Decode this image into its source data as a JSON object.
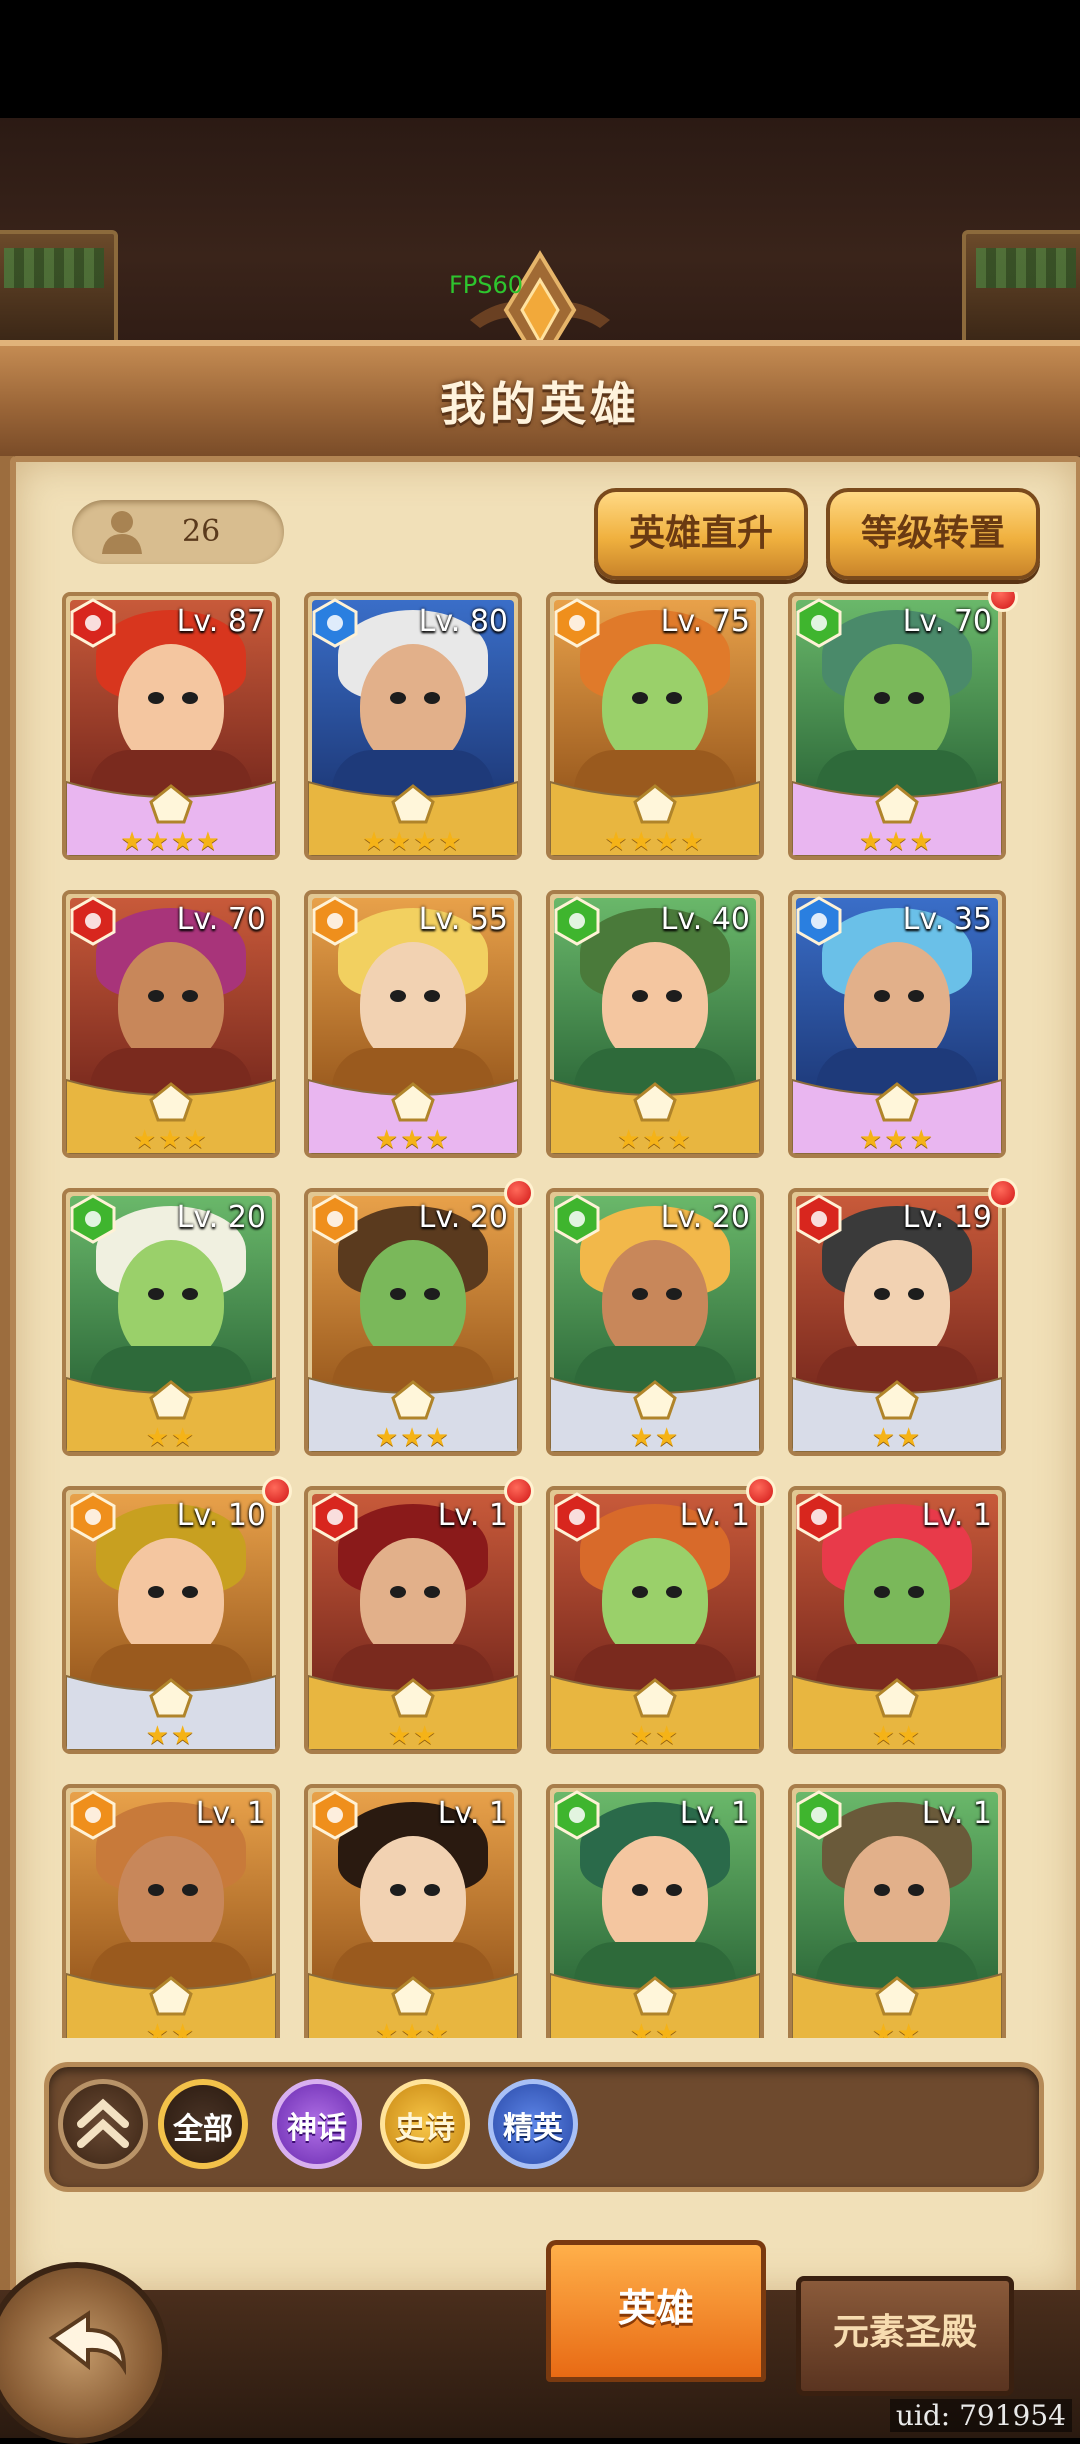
{
  "fps": "FPS60",
  "header": {
    "title": "我的英雄"
  },
  "hero_count": "26",
  "buttons": {
    "upgrade": "英雄直升",
    "transfer": "等级转置"
  },
  "colors": {
    "fire": "#d8261e",
    "water": "#2a7fe0",
    "earth": "#ef8f1c",
    "wind": "#3fb52e"
  },
  "heroes": [
    {
      "level": "Lv. 87",
      "element": "fire",
      "stars": "★★★★",
      "dot": false,
      "rarity": "mythic"
    },
    {
      "level": "Lv. 80",
      "element": "water",
      "stars": "★★★★",
      "dot": false,
      "rarity": "epic"
    },
    {
      "level": "Lv. 75",
      "element": "earth",
      "stars": "★★★★",
      "dot": false,
      "rarity": "epic"
    },
    {
      "level": "Lv. 70",
      "element": "wind",
      "stars": "★★★",
      "dot": true,
      "rarity": "mythic"
    },
    {
      "level": "Lv. 70",
      "element": "fire",
      "stars": "★★★",
      "dot": false,
      "rarity": "epic"
    },
    {
      "level": "Lv. 55",
      "element": "earth",
      "stars": "★★★",
      "dot": false,
      "rarity": "mythic"
    },
    {
      "level": "Lv. 40",
      "element": "wind",
      "stars": "★★★",
      "dot": false,
      "rarity": "epic"
    },
    {
      "level": "Lv. 35",
      "element": "water",
      "stars": "★★★",
      "dot": false,
      "rarity": "mythic"
    },
    {
      "level": "Lv. 20",
      "element": "wind",
      "stars": "★★",
      "dot": false,
      "rarity": "epic"
    },
    {
      "level": "Lv. 20",
      "element": "earth",
      "stars": "★★★",
      "dot": true,
      "rarity": "elite"
    },
    {
      "level": "Lv. 20",
      "element": "wind",
      "stars": "★★",
      "dot": false,
      "rarity": "elite"
    },
    {
      "level": "Lv. 19",
      "element": "fire",
      "stars": "★★",
      "dot": true,
      "rarity": "elite"
    },
    {
      "level": "Lv. 10",
      "element": "earth",
      "stars": "★★",
      "dot": true,
      "rarity": "elite"
    },
    {
      "level": "Lv. 1",
      "element": "fire",
      "stars": "★★",
      "dot": true,
      "rarity": "epic"
    },
    {
      "level": "Lv. 1",
      "element": "fire",
      "stars": "★★",
      "dot": true,
      "rarity": "epic"
    },
    {
      "level": "Lv. 1",
      "element": "fire",
      "stars": "★★",
      "dot": false,
      "rarity": "epic"
    },
    {
      "level": "Lv. 1",
      "element": "earth",
      "stars": "★★",
      "dot": false,
      "rarity": "epic"
    },
    {
      "level": "Lv. 1",
      "element": "earth",
      "stars": "★★★",
      "dot": false,
      "rarity": "epic"
    },
    {
      "level": "Lv. 1",
      "element": "wind",
      "stars": "★★",
      "dot": false,
      "rarity": "epic"
    },
    {
      "level": "Lv. 1",
      "element": "wind",
      "stars": "★★",
      "dot": false,
      "rarity": "epic"
    }
  ],
  "filters": {
    "all": "全部",
    "myth": "神话",
    "epic": "史诗",
    "elite": "精英"
  },
  "tabs": {
    "heroes": "英雄",
    "temple": "元素圣殿"
  },
  "uid": "uid: 791954"
}
